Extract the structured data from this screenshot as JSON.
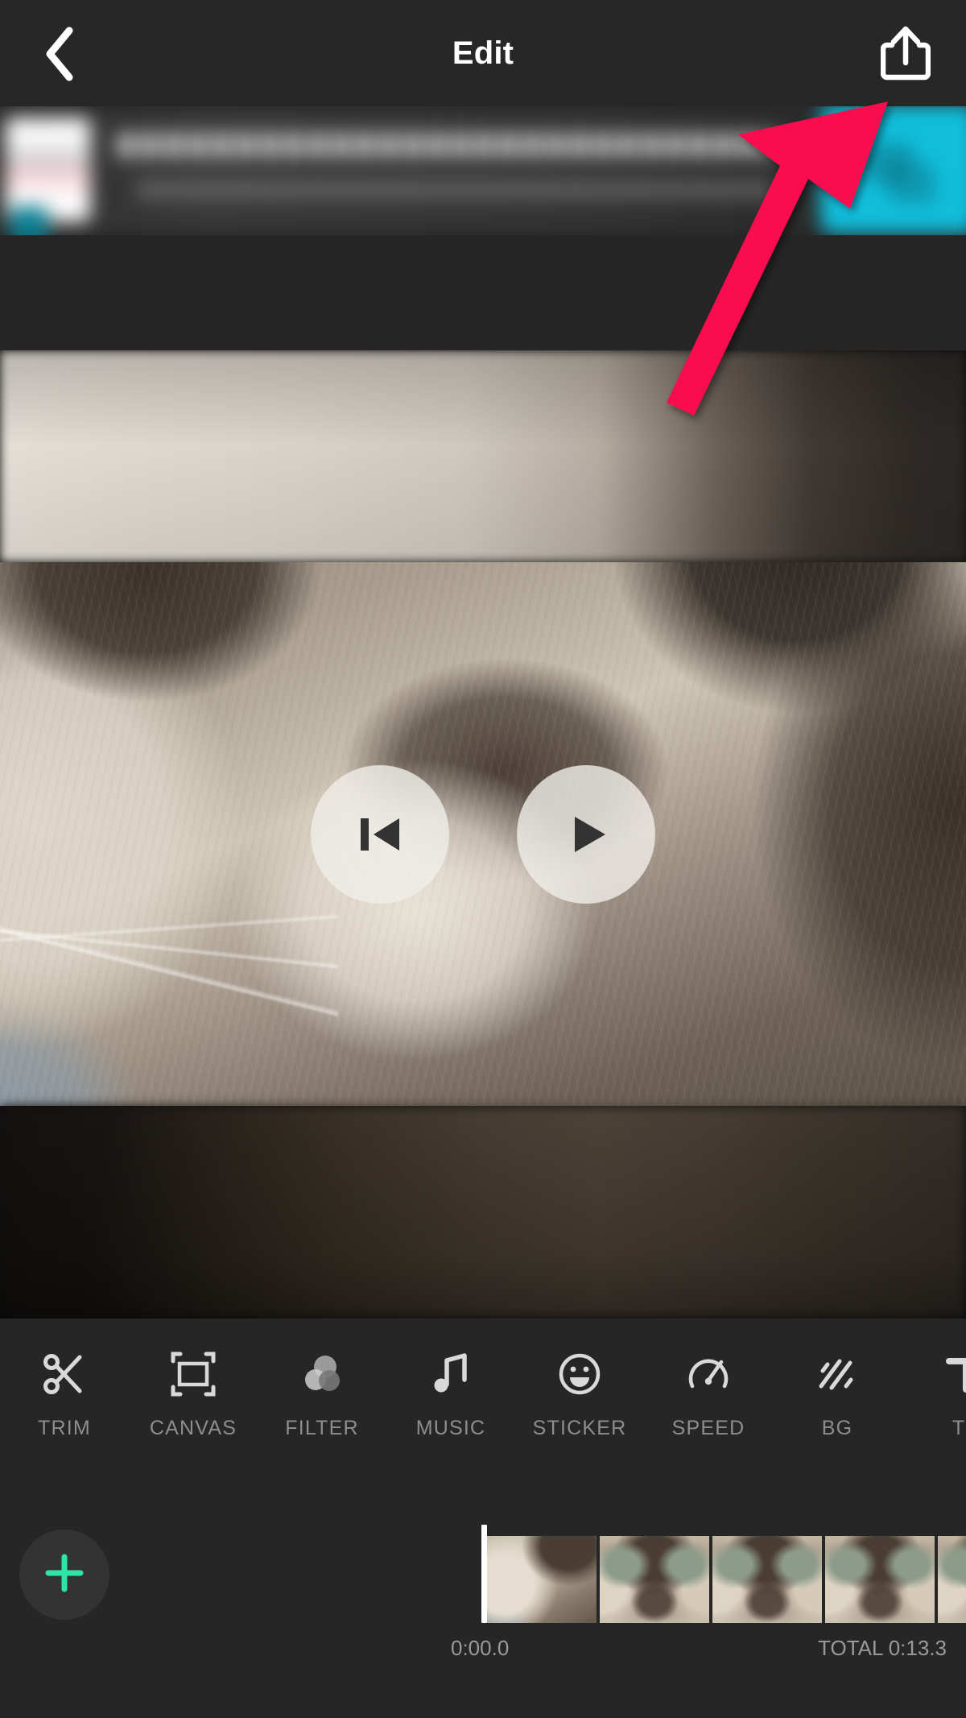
{
  "app": {
    "name": "video-editor",
    "theme_bg": "#262626",
    "accent_green": "#2ce6a8",
    "accent_cyan": "#11bedc",
    "annotation_color": "#fa0a50"
  },
  "header": {
    "title": "Edit",
    "back_icon": "chevron-left-icon",
    "share_icon": "share-export-icon"
  },
  "promo_banner": {
    "blurred": true,
    "thumbnail": "app-thumbnail",
    "line1": "",
    "line2": "",
    "cta_color": "#11bedc"
  },
  "preview": {
    "letterbox_top": true,
    "letterbox_bottom": true,
    "controls": [
      {
        "name": "skip-to-start-button",
        "icon": "skip-back-icon"
      },
      {
        "name": "play-button",
        "icon": "play-icon"
      }
    ]
  },
  "toolbar": {
    "items": [
      {
        "label": "TRIM",
        "icon": "scissors-icon"
      },
      {
        "label": "CANVAS",
        "icon": "crop-frame-icon"
      },
      {
        "label": "FILTER",
        "icon": "three-circles-icon"
      },
      {
        "label": "MUSIC",
        "icon": "music-note-icon"
      },
      {
        "label": "STICKER",
        "icon": "smiley-icon"
      },
      {
        "label": "SPEED",
        "icon": "speedometer-icon"
      },
      {
        "label": "BG",
        "icon": "diagonal-lines-icon"
      },
      {
        "label": "TE",
        "icon": "text-t-icon"
      }
    ]
  },
  "timeline": {
    "add_clip_icon": "plus-icon",
    "current_time": "0:00.0",
    "total_time": "TOTAL 0:13.3",
    "playhead_position": "0",
    "frames": [
      1,
      2,
      3,
      4,
      5
    ]
  },
  "annotation": {
    "type": "arrow",
    "points_to": "share-export-icon",
    "color": "#fa0a50"
  }
}
